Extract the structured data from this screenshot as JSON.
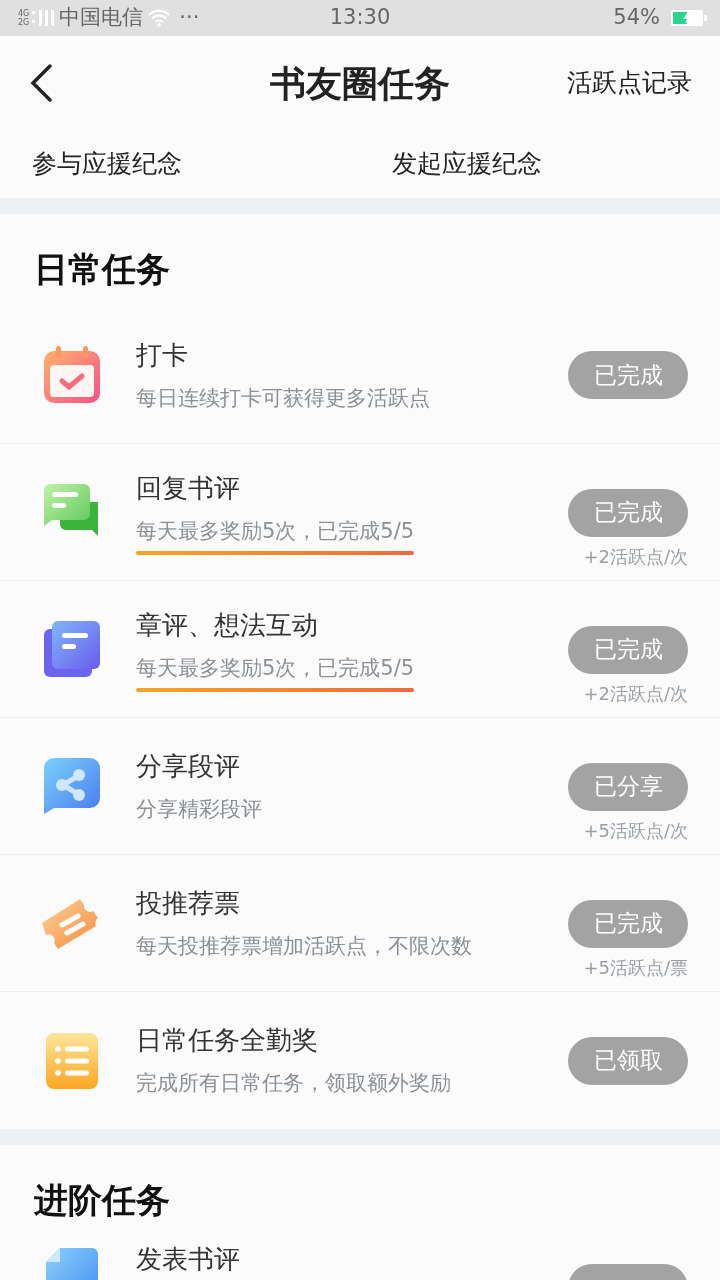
{
  "status_bar": {
    "network": "4G\n2G",
    "carrier": "中国电信",
    "more": "···",
    "time": "13:30",
    "battery": "54%",
    "charging": true
  },
  "header": {
    "title": "书友圈任务",
    "action": "活跃点记录"
  },
  "support_links": [
    "参与应援纪念",
    "发起应援纪念"
  ],
  "sections": [
    {
      "title": "日常任务",
      "tasks": [
        {
          "kind": "calendar",
          "title": "打卡",
          "subtitle": "每日连续打卡可获得更多活跃点",
          "button": {
            "label": "已完成",
            "disabled": true
          }
        },
        {
          "kind": "chat",
          "title": "回复书评",
          "subtitle": "每天最多奖励5次，已完成5/5",
          "highlight": true,
          "button": {
            "label": "已完成",
            "disabled": true
          },
          "reward": "+2活跃点/次"
        },
        {
          "kind": "docs",
          "title": "章评、想法互动",
          "subtitle": "每天最多奖励5次，已完成5/5",
          "highlight": true,
          "button": {
            "label": "已完成",
            "disabled": true
          },
          "reward": "+2活跃点/次"
        },
        {
          "kind": "share",
          "title": "分享段评",
          "subtitle": "分享精彩段评",
          "button": {
            "label": "已分享",
            "disabled": true
          },
          "reward": "+5活跃点/次"
        },
        {
          "kind": "ticket",
          "title": "投推荐票",
          "subtitle": "每天投推荐票增加活跃点，不限次数",
          "button": {
            "label": "已完成",
            "disabled": true
          },
          "reward": "+5活跃点/票"
        },
        {
          "kind": "list",
          "title": "日常任务全勤奖",
          "subtitle": "完成所有日常任务，领取额外奖励",
          "button": {
            "label": "已领取",
            "disabled": true
          }
        }
      ]
    },
    {
      "title": "进阶任务",
      "tasks": [
        {
          "kind": "doc",
          "title": "发表书评",
          "button": {
            "disabled": true
          }
        }
      ]
    }
  ]
}
